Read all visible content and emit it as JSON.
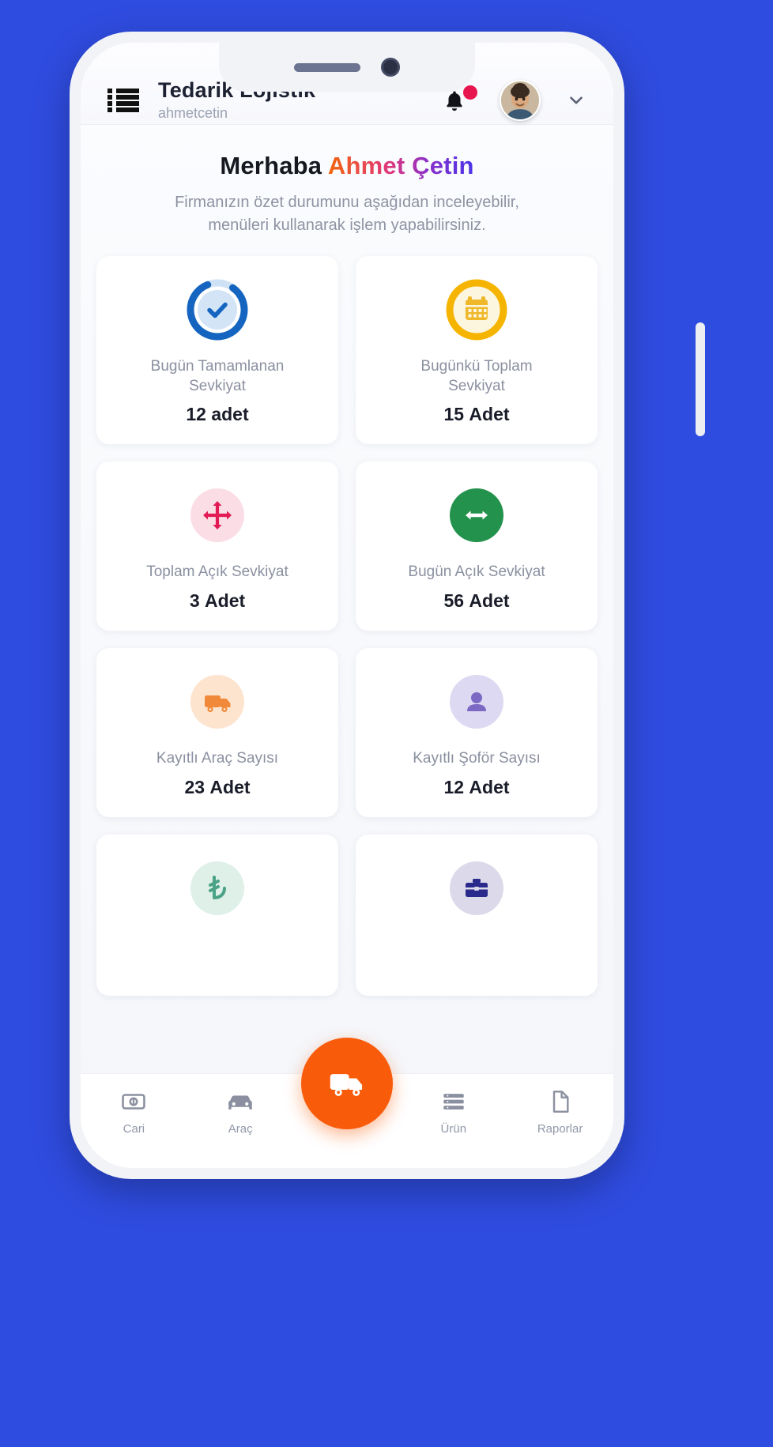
{
  "colors": {
    "page_background": "#2f4ce0",
    "fab": "#f85c0a",
    "notification_dot": "#e8164f",
    "blue_ring": "#1565c0",
    "yellow_ring": "#f5b400",
    "pink_soft": "#fbdde6",
    "crimson": "#e21b54",
    "green": "#23924d",
    "orange_soft": "#fde4cf",
    "orange": "#f08a3a",
    "purple_soft": "#ded9f2",
    "purple": "#7b69c4",
    "mint_soft": "#dff0e8",
    "teal": "#4aa287",
    "lavender_soft": "#dcd9ea",
    "navy": "#2a2a8c"
  },
  "header": {
    "menu_icon": "list-menu-icon",
    "title": "Tedarik Lojistik",
    "subtitle": "ahmetcetin",
    "bell_icon": "bell-icon",
    "has_notification": true,
    "avatar_icon": "user-avatar",
    "chevron_icon": "chevron-down-icon"
  },
  "greeting": {
    "hello": "Merhaba ",
    "name": "Ahmet Çetin",
    "description_line1": "Firmanızın özet durumunu aşağıdan inceleyebilir,",
    "description_line2": "menüleri kullanarak işlem yapabilirsiniz."
  },
  "cards": [
    {
      "icon": "check-circle-progress-icon",
      "label_line1": "Bugün Tamamlanan",
      "label_line2": "Sevkiyat",
      "value_number": "12",
      "value_unit": "adet"
    },
    {
      "icon": "calendar-icon",
      "label_line1": "Bugünkü Toplam",
      "label_line2": "Sevkiyat",
      "value_number": "15",
      "value_unit": "Adet"
    },
    {
      "icon": "move-arrows-icon",
      "label_line1": "Toplam Açık Sevkiyat",
      "label_line2": "",
      "value_number": "3",
      "value_unit": "Adet"
    },
    {
      "icon": "left-right-arrows-icon",
      "label_line1": "Bugün Açık Sevkiyat",
      "label_line2": "",
      "value_number": "56",
      "value_unit": "Adet"
    },
    {
      "icon": "truck-icon",
      "label_line1": "Kayıtlı Araç Sayısı",
      "label_line2": "",
      "value_number": "23",
      "value_unit": "Adet"
    },
    {
      "icon": "user-icon",
      "label_line1": "Kayıtlı Şoför Sayısı",
      "label_line2": "",
      "value_number": "12",
      "value_unit": "Adet"
    },
    {
      "icon": "lira-icon",
      "label_line1": "",
      "label_line2": "",
      "value_number": "",
      "value_unit": ""
    },
    {
      "icon": "briefcase-icon",
      "label_line1": "",
      "label_line2": "",
      "value_number": "",
      "value_unit": ""
    }
  ],
  "bottom_nav": {
    "items": [
      {
        "icon": "cash-icon",
        "label": "Cari"
      },
      {
        "icon": "car-icon",
        "label": "Araç"
      },
      {
        "icon": "layers-icon",
        "label": "Ürün"
      },
      {
        "icon": "document-icon",
        "label": "Raporlar"
      }
    ],
    "fab_icon": "truck-icon"
  }
}
